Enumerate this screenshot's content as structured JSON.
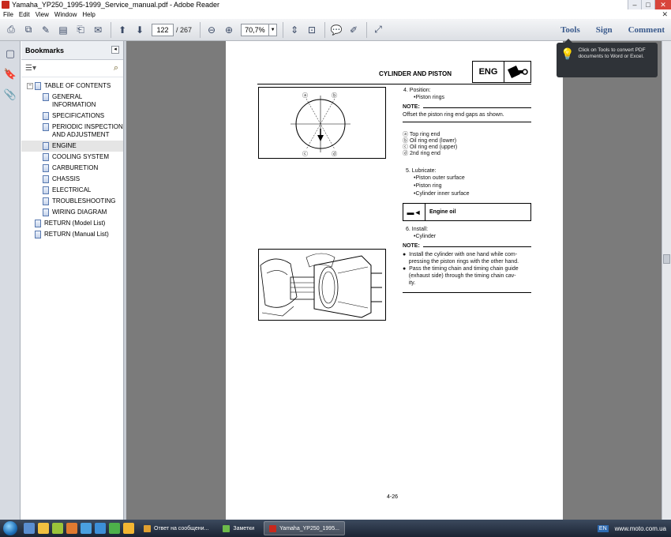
{
  "window": {
    "title": "Yamaha_YP250_1995-1999_Service_manual.pdf - Adobe Reader",
    "minimize": "–",
    "maximize": "□",
    "close": "✕",
    "doc_close": "✕"
  },
  "menu": [
    "File",
    "Edit",
    "View",
    "Window",
    "Help"
  ],
  "toolbar": {
    "current_page": "122",
    "page_separator": "/",
    "total_pages": "267",
    "zoom": "70,7%",
    "tools_label": "Tools",
    "sign_label": "Sign",
    "comment_label": "Comment"
  },
  "bookmarks": {
    "title": "Bookmarks",
    "items": [
      {
        "label": "TABLE OF CONTENTS",
        "level": 0,
        "toggle": "−"
      },
      {
        "label": "GENERAL INFORMATION",
        "level": 1
      },
      {
        "label": "SPECIFICATIONS",
        "level": 1
      },
      {
        "label": "PERIODIC INSPECTION AND ADJUSTMENT",
        "level": 1
      },
      {
        "label": "ENGINE",
        "level": 1,
        "selected": true
      },
      {
        "label": "COOLING SYSTEM",
        "level": 1
      },
      {
        "label": "CARBURETION",
        "level": 1
      },
      {
        "label": "CHASSIS",
        "level": 1
      },
      {
        "label": "ELECTRICAL",
        "level": 1
      },
      {
        "label": "TROUBLESHOOTING",
        "level": 1
      },
      {
        "label": "WIRING DIAGRAM",
        "level": 1
      },
      {
        "label": "RETURN (Model List)",
        "level": 0
      },
      {
        "label": "RETURN (Manual List)",
        "level": 0
      }
    ]
  },
  "tooltip": {
    "text": "Click on Tools to convert PDF documents to Word or Excel."
  },
  "page": {
    "section_title": "CYLINDER AND PISTON",
    "section_tag": "ENG",
    "step4_title": "4.  Position:",
    "step4_item": "•Piston rings",
    "note1_label": "NOTE:",
    "note1_text": "Offset the piston ring end gaps as shown.",
    "legend": [
      "ⓐ Top ring end",
      "ⓑ Oil ring end (lower)",
      "ⓒ Oil ring end (upper)",
      "ⓓ 2nd ring end"
    ],
    "fig_labels": [
      "ⓐ",
      "ⓑ",
      "ⓒ",
      "ⓓ"
    ],
    "step5_title": "5.  Lubricate:",
    "step5_items": [
      "•Piston outer surface",
      "•Piston ring",
      "•Cylinder inner surface"
    ],
    "oil_label": "Engine oil",
    "step6_title": "6.  Install:",
    "step6_item": "•Cylinder",
    "note2_label": "NOTE:",
    "note2_bullets": [
      "●  Install the cylinder with one hand while com-",
      "    pressing the piston rings with the other hand.",
      "●  Pass the timing chain and timing chain guide",
      "    (exhaust side) through the timing chain cav-",
      "    ity."
    ],
    "page_number": "4-26"
  },
  "taskbar": {
    "tasks": [
      {
        "label": "Ответ на сообщени...",
        "color": "#e0a030"
      },
      {
        "label": "Заметки",
        "color": "#6dbb4a"
      },
      {
        "label": "Yamaha_YP250_1995...",
        "color": "#c8281c",
        "active": true
      }
    ],
    "lang": "EN",
    "watermark": "www.moto.com.ua"
  }
}
